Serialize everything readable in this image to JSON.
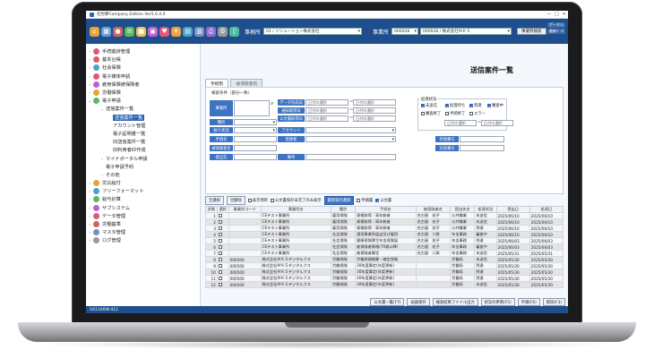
{
  "window": {
    "title": "社労夢Company Edition Ver5.0.4.0",
    "controls": [
      "—",
      "□",
      "✕"
    ]
  },
  "toolbar": {
    "icons": [
      {
        "name": "home-icon",
        "glyph": "⌂",
        "color": "#e8a33a"
      },
      {
        "name": "building-icon",
        "glyph": "▦",
        "color": "#6aa0d8"
      },
      {
        "name": "person-icon",
        "glyph": "●",
        "color": "#d95f5f"
      },
      {
        "name": "envelope-icon",
        "glyph": "✉",
        "color": "#5cb85c"
      },
      {
        "name": "folder-icon",
        "glyph": "■",
        "color": "#f0c24b"
      },
      {
        "name": "briefcase-icon",
        "glyph": "▣",
        "color": "#c15fd0"
      },
      {
        "name": "heart-icon",
        "glyph": "♥",
        "color": "#e0587a"
      },
      {
        "name": "sun-icon",
        "glyph": "☀",
        "color": "#f0a13a"
      },
      {
        "name": "calendar-icon",
        "glyph": "▤",
        "color": "#4aa3c9"
      },
      {
        "name": "calculator-icon",
        "glyph": "▥",
        "color": "#7a8fbf"
      },
      {
        "name": "printer-icon",
        "glyph": "⎙",
        "color": "#8e6bd0"
      },
      {
        "name": "gear-icon",
        "glyph": "⚙",
        "color": "#9a9a9a"
      },
      {
        "name": "document-icon",
        "glyph": "▯",
        "color": "#4fb8a0"
      }
    ],
    "office_label": "事務所",
    "office_value": "01 / ソリューション株式会社",
    "client_label": "事業所",
    "client_code": "000028",
    "client_value": "000028 / 株式会社ＭＫＳ",
    "client_search_button": "事業所検索",
    "right_small_1": "ポータル",
    "right_small_2": "最新ﾃﾞｰﾀ"
  },
  "sidebar": {
    "items": [
      {
        "label": "手続進捗管理",
        "level": 0,
        "color": "#e0587a",
        "caret": "›"
      },
      {
        "label": "基本台帳",
        "level": 0,
        "color": "#d95f5f",
        "caret": "›"
      },
      {
        "label": "社会保険",
        "level": 0,
        "color": "#4aa3c9",
        "caret": "›"
      },
      {
        "label": "電子媒体申請",
        "level": 0,
        "color": "#e0587a",
        "caret": "›"
      },
      {
        "label": "雇用保険被保険者",
        "level": 0,
        "color": "#c15fd0",
        "caret": "›"
      },
      {
        "label": "労働保険",
        "level": 0,
        "color": "#e8a33a",
        "caret": "›"
      },
      {
        "label": "電子申請",
        "level": 0,
        "color": "#5cb85c",
        "caret": "⌄"
      },
      {
        "label": "送信案件一覧",
        "level": 1,
        "color": "",
        "caret": "⌄"
      },
      {
        "label": "送信案件一覧",
        "level": 2,
        "color": "",
        "caret": "",
        "selected": true
      },
      {
        "label": "アカウント管理",
        "level": 2,
        "color": "",
        "caret": ""
      },
      {
        "label": "電子証明書一覧",
        "level": 2,
        "color": "",
        "caret": ""
      },
      {
        "label": "旧送信案件一覧",
        "level": 2,
        "color": "",
        "caret": ""
      },
      {
        "label": "旧利用者ID作成",
        "level": 2,
        "color": "",
        "caret": ""
      },
      {
        "label": "マイナポータル申請",
        "level": 1,
        "color": "",
        "caret": "›"
      },
      {
        "label": "電子申請予約",
        "level": 1,
        "color": "",
        "caret": ""
      },
      {
        "label": "その他",
        "level": 1,
        "color": "",
        "caret": "›"
      },
      {
        "label": "労災給付",
        "level": 0,
        "color": "#e8a33a",
        "caret": "›"
      },
      {
        "label": "フリーフォーマット",
        "level": 0,
        "color": "#4aa3c9",
        "caret": "›"
      },
      {
        "label": "給与計算",
        "level": 0,
        "color": "#5cb85c",
        "caret": "›"
      },
      {
        "label": "サブシステム",
        "level": 0,
        "color": "#c15fd0",
        "caret": "›"
      },
      {
        "label": "データ管理",
        "level": 0,
        "color": "#e0587a",
        "caret": "›"
      },
      {
        "label": "労働基準",
        "level": 0,
        "color": "#d95f5f",
        "caret": "›"
      },
      {
        "label": "マスタ管理",
        "level": 0,
        "color": "#7a8fbf",
        "caret": "›"
      },
      {
        "label": "ログ管理",
        "level": 0,
        "color": "#9a9a9a",
        "caret": "›"
      }
    ]
  },
  "page": {
    "title": "送信案件一覧",
    "tabs": [
      "手続別",
      "被保険者別"
    ]
  },
  "search": {
    "legend": "検索条件（部分一致）",
    "labels": {
      "jimusho": "事業所",
      "data_date": "データ作成日",
      "notice_date": "通知取得日",
      "pub_date": "公文書取得日",
      "kind": "種別",
      "send_status": "紛り状況",
      "account": "アカウント",
      "procedure": "手続名",
      "registrant": "登録者",
      "arrival_no": "到達番号",
      "insured_name": "被保険者名",
      "separate_no": "別途番号",
      "destination": "提出先",
      "memo": "備考"
    },
    "date_placeholder": "日付の選択",
    "status": {
      "title": "処理状況",
      "options": [
        {
          "label": "未送信",
          "checked": true
        },
        {
          "label": "処理待ち",
          "checked": true
        },
        {
          "label": "到達",
          "checked": true
        },
        {
          "label": "審査中",
          "checked": true
        },
        {
          "label": "審査終了",
          "checked": false
        },
        {
          "label": "手続終了",
          "checked": false
        },
        {
          "label": "エラー",
          "checked": false
        }
      ]
    }
  },
  "actions": {
    "select_all": "全選択",
    "clear_all": "全解除",
    "display_label": "表示項目",
    "checkbox_1": "公文書保存未完了のみ表示",
    "filter_button": "最新保存選択",
    "checkbox_2": "申請書",
    "checkbox_3": "公文書"
  },
  "table": {
    "headers": [
      "状態",
      "選択",
      "事業所コード",
      "事業所名",
      "種別",
      "手続名",
      "被保険者名",
      "提出先名",
      "処理状況",
      "提出日",
      "処理日"
    ],
    "rows": [
      [
        "1",
        "",
        "",
        "CEテスト事業所",
        "雇用保険",
        "資格取得／高年齢者",
        "名古屋　花子",
        "公共職業",
        "未送信",
        "2025/06/10",
        "2025/06/10"
      ],
      [
        "2",
        "",
        "",
        "CEテスト事業所",
        "雇用保険",
        "資格取得／高年齢者",
        "名古屋　花子",
        "公共職業",
        "未送信",
        "2025/06/10",
        "2025/06/10"
      ],
      [
        "3",
        "",
        "",
        "CEテスト事業所",
        "雇用保険",
        "資格取得／高年齢者",
        "名古屋　花子",
        "公共職業",
        "到達",
        "2025/06/10",
        "2025/06/10"
      ],
      [
        "4",
        "",
        "",
        "CEテスト事業所",
        "社会保険",
        "適用事業所届出及び雇用",
        "名古屋　二郎",
        "年金事務",
        "審査中",
        "2025/06/10",
        "2025/06/10"
      ],
      [
        "5",
        "",
        "",
        "CEテスト事業所",
        "社会保険",
        "健康保険厚生年金保険届",
        "名古屋　花子",
        "年金事務",
        "到達",
        "2025/06/03",
        "2025/06/03"
      ],
      [
        "6",
        "",
        "",
        "CEテスト事業所",
        "社会保険",
        "被保険者資格(70歳以降)",
        "名古屋　花子",
        "年金事務",
        "審査中",
        "2025/06/03",
        "2025/06/03"
      ],
      [
        "7",
        "",
        "",
        "CEテスト事業所",
        "社会保険",
        "被保険者算定",
        "名古屋　二郎",
        "年金事務",
        "未送信",
        "2025/05/31",
        "2025/05/31"
      ],
      [
        "8",
        "",
        "000500",
        "株式会社ＭＫＳデジタルクス",
        "労働保険",
        "労働保険概算・確定保険",
        "",
        "労働局",
        "未送信",
        "2025/05/30",
        "2025/05/30"
      ],
      [
        "9",
        "",
        "000500",
        "株式会社ＭＫＳデジタルクス",
        "労働保険",
        "30年度算定(年度更新)",
        "",
        "労働局",
        "到達",
        "2025/05/30",
        "2025/05/30"
      ],
      [
        "10",
        "",
        "000500",
        "株式会社ＭＫＳデジタルクス",
        "労働保険",
        "30年度算定(年度更新)",
        "",
        "労働局",
        "到達",
        "2025/05/30",
        "2025/05/30"
      ],
      [
        "11",
        "",
        "000500",
        "株式会社ＭＫＳデジタルクス",
        "労働保険",
        "30年度算定(年度更新)",
        "",
        "労働局",
        "到達",
        "2025/05/30",
        "2025/05/30"
      ],
      [
        "12",
        "",
        "000500",
        "株式会社ＭＫＳデジタルクス",
        "労働保険",
        "30年度算定(年度更新)",
        "",
        "労働局",
        "未送信",
        "2025/05/30",
        "2025/05/30"
      ]
    ]
  },
  "bottom_buttons": [
    "公文書一覧(F7)",
    "画面保存",
    "検索結果ファイル出力",
    "状況の更新(F5)",
    "申請(F6)",
    "削除(F3)"
  ],
  "statusbar": {
    "text": "SA1100W-412"
  }
}
